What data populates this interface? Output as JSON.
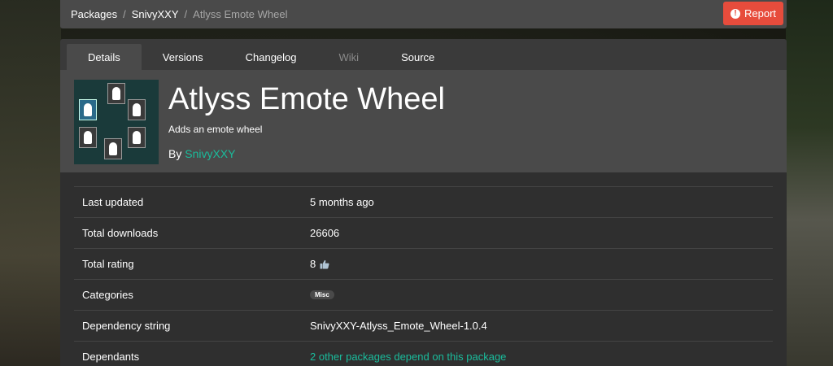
{
  "breadcrumb": {
    "packages": "Packages",
    "author": "SnivyXXY",
    "current": "Atlyss Emote Wheel",
    "separator": "/"
  },
  "report": {
    "label": "Report",
    "color": "#e74c3c"
  },
  "tabs": [
    {
      "label": "Details",
      "state": "active"
    },
    {
      "label": "Versions",
      "state": "normal"
    },
    {
      "label": "Changelog",
      "state": "normal"
    },
    {
      "label": "Wiki",
      "state": "disabled"
    },
    {
      "label": "Source",
      "state": "normal"
    }
  ],
  "package": {
    "title": "Atlyss Emote Wheel",
    "description": "Adds an emote wheel",
    "by_prefix": "By",
    "author": "SnivyXXY",
    "accent": "#1abc9c"
  },
  "info": {
    "last_updated": {
      "label": "Last updated",
      "value": "5 months ago"
    },
    "total_downloads": {
      "label": "Total downloads",
      "value": "26606"
    },
    "total_rating": {
      "label": "Total rating",
      "value": "8",
      "icon": "thumbs-up-icon"
    },
    "categories": {
      "label": "Categories",
      "value": "Misc"
    },
    "dependency_string": {
      "label": "Dependency string",
      "value": "SnivyXXY-Atlyss_Emote_Wheel-1.0.4"
    },
    "dependants": {
      "label": "Dependants",
      "value": "2 other packages depend on this package"
    }
  }
}
